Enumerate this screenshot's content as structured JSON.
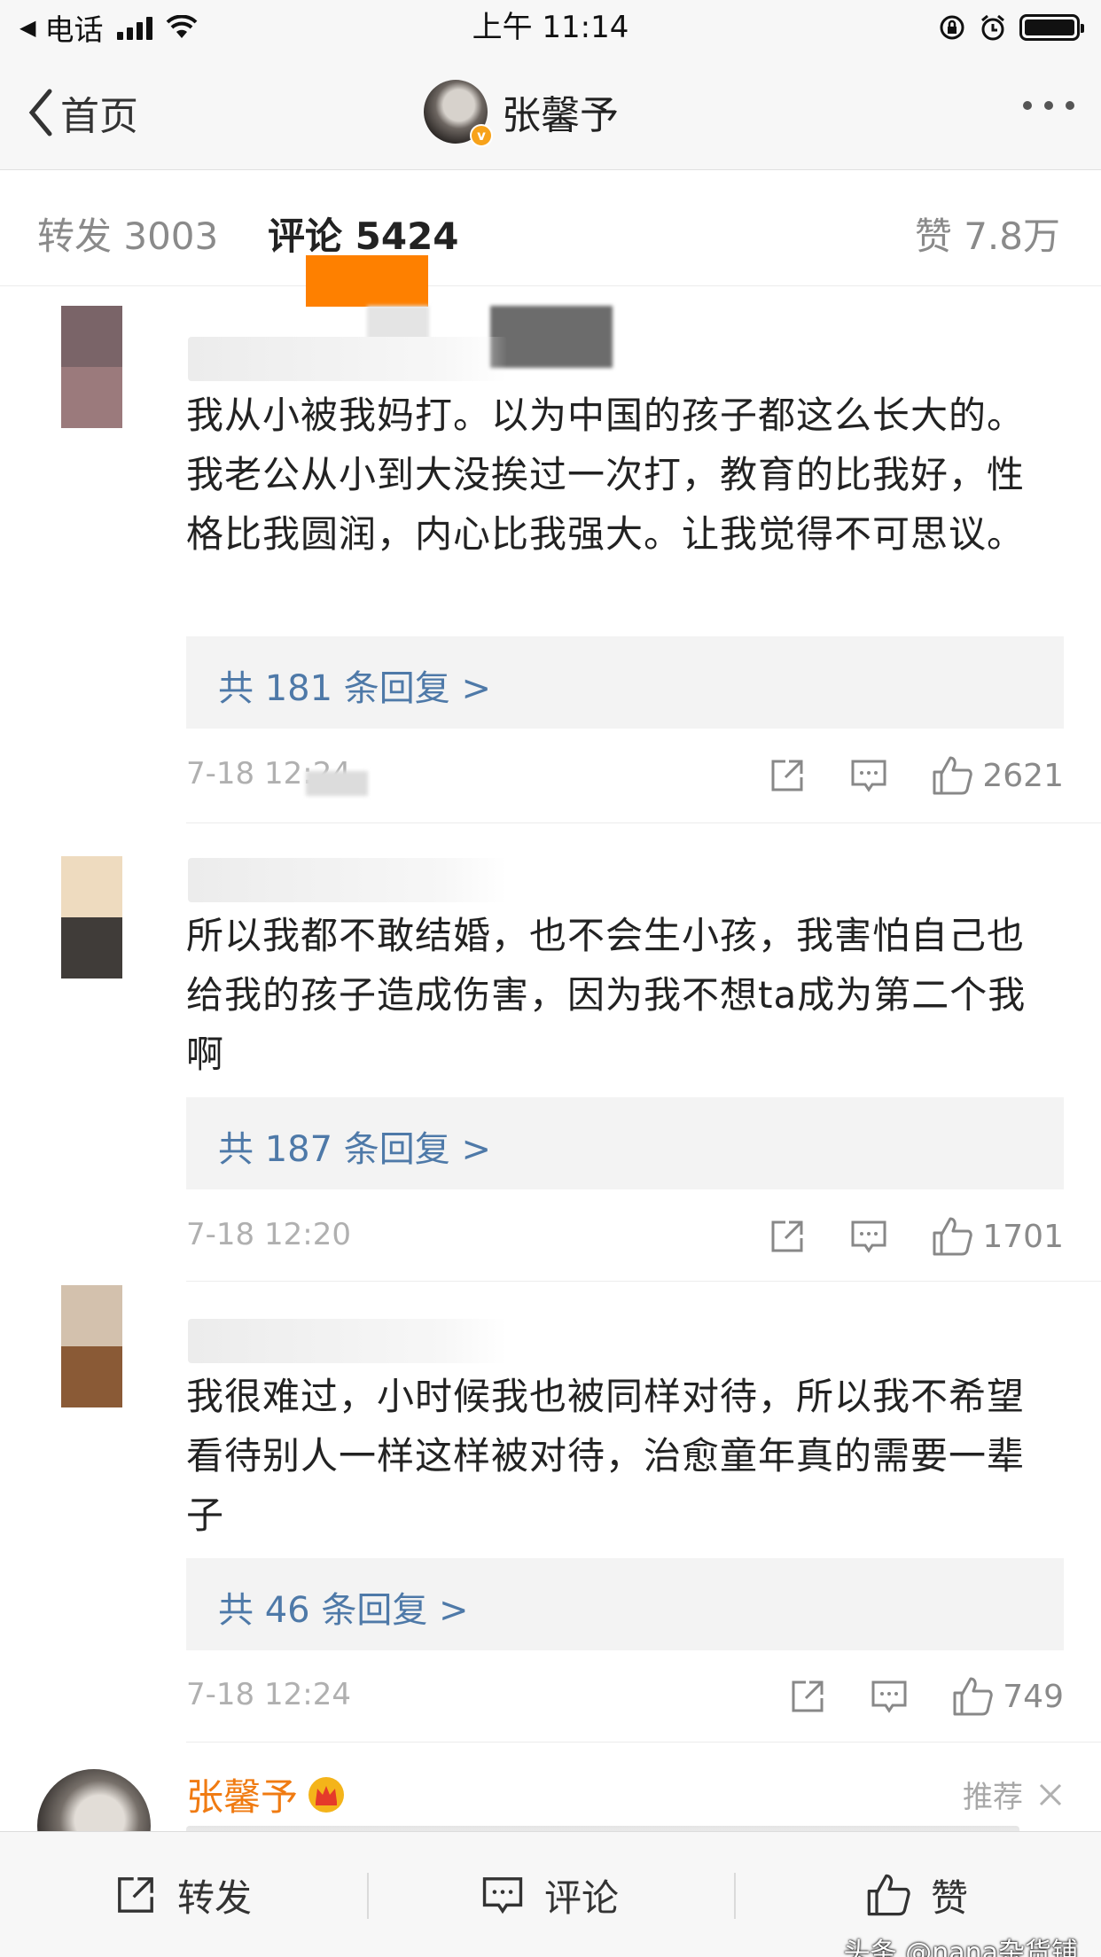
{
  "status_bar": {
    "carrier": "电话",
    "time": "上午 11:14"
  },
  "nav": {
    "back_label": "首页",
    "title": "张馨予"
  },
  "tabs": {
    "repost": "转发 3003",
    "comment": "评论 5424",
    "like": "赞 7.8万"
  },
  "comments": [
    {
      "avatar_colors": [
        "#7a6468",
        "#9b7a7c"
      ],
      "text": "我从小被我妈打。以为中国的孩子都这么长大的。我老公从小到大没挨过一次打，教育的比我好，性格比我圆润，内心比我强大。让我觉得不可思议。",
      "replies": "共 181 条回复 >",
      "time": "7-18 12:24",
      "likes": "2621"
    },
    {
      "avatar_colors": [
        "#eedbbf",
        "#403c39"
      ],
      "text": "所以我都不敢结婚，也不会生小孩，我害怕自己也给我的孩子造成伤害，因为我不想ta成为第二个我啊",
      "replies": "共 187 条回复 >",
      "time": "7-18 12:20",
      "likes": "1701"
    },
    {
      "avatar_colors": [
        "#d3c1ad",
        "#8a5a36"
      ],
      "text": "我很难过，小时候我也被同样对待，所以我不希望看待别人一样这样被对待，治愈童年真的需要一辈子",
      "replies": "共 46 条回复 >",
      "time": "7-18 12:24",
      "likes": "749"
    }
  ],
  "author_comment": {
    "name": "张馨予",
    "recommend": "推荐"
  },
  "bottom_bar": {
    "repost": "转发",
    "comment": "评论",
    "like": "赞"
  },
  "watermark": "头条 @nana杂货铺",
  "icons": {
    "share": "share-icon",
    "reply": "comment-icon",
    "like": "thumbs-up-icon",
    "crown": "crown-icon",
    "close": "close-icon"
  },
  "colors": {
    "link_blue": "#4e79a8",
    "author_orange": "#f07b12",
    "tab_indicator": "#fe8000"
  }
}
